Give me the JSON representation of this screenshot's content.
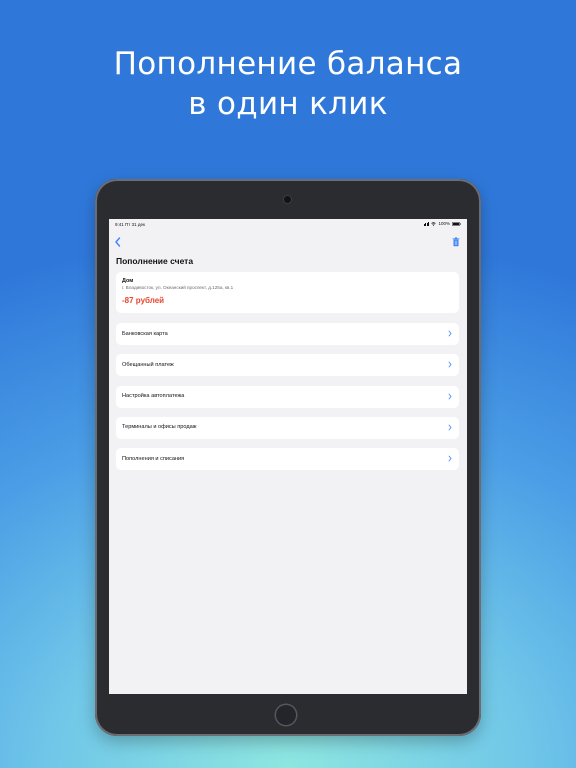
{
  "promo": {
    "title_line1": "Пополнение баланса",
    "title_line2": "в один клик"
  },
  "status_bar": {
    "time": "9:41",
    "date": "Пт 31 дек",
    "battery": "100%",
    "icons": [
      "signal-icon",
      "wifi-icon",
      "battery-icon"
    ]
  },
  "navbar": {
    "back_icon": "chevron-left-icon",
    "action_icon": "trash-icon"
  },
  "page": {
    "title": "Пополнение счета"
  },
  "account": {
    "name": "Дом",
    "address": "г. Владивосток, ул. Океанский проспект, д.125а, кв.1",
    "balance": "-87 рублей"
  },
  "menu": {
    "items": [
      {
        "label": "Банковская карта"
      },
      {
        "label": "Обещанный платеж"
      },
      {
        "label": "Настройка автоплатежа"
      },
      {
        "label": "Терминалы и офисы продаж"
      },
      {
        "label": "Пополнения и списания"
      }
    ]
  },
  "colors": {
    "accent": "#3b82f6",
    "negative_balance": "#e8452d",
    "background_top": "#2f78da",
    "background_bottom": "#8ee6e0",
    "device_frame": "#2b2c30",
    "screen_background": "#f2f2f4"
  }
}
